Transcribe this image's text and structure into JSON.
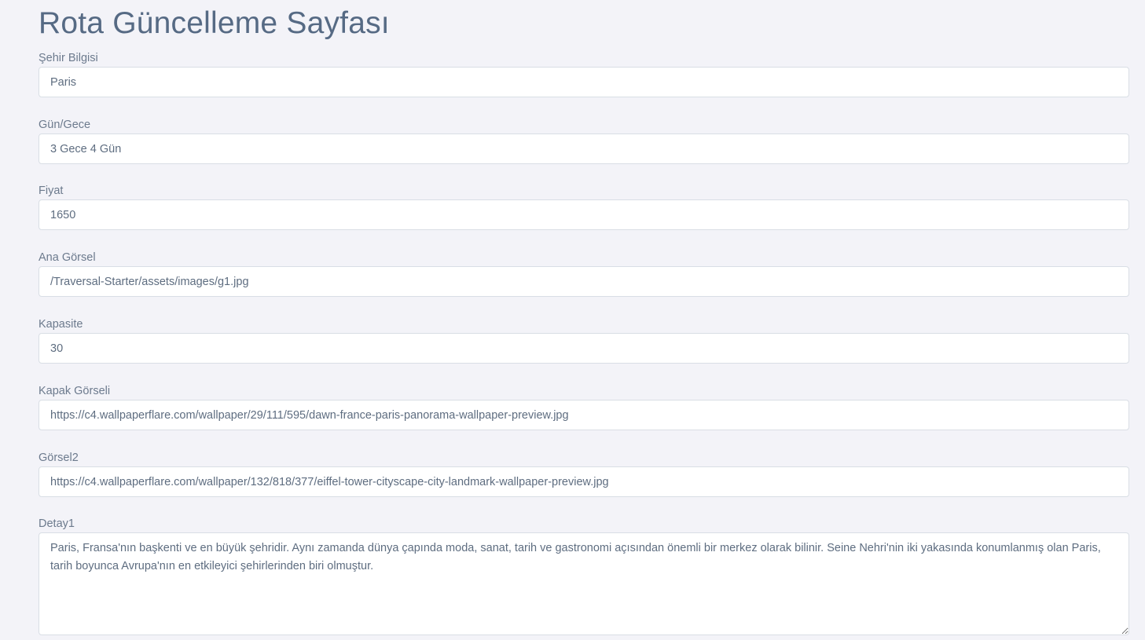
{
  "page": {
    "title": "Rota Güncelleme Sayfası"
  },
  "fields": {
    "city": {
      "label": "Şehir Bilgisi",
      "value": "Paris"
    },
    "day_night": {
      "label": "Gün/Gece",
      "value": "3 Gece 4 Gün"
    },
    "price": {
      "label": "Fiyat",
      "value": "1650"
    },
    "main_image": {
      "label": "Ana Görsel",
      "value": "/Traversal-Starter/assets/images/g1.jpg"
    },
    "capacity": {
      "label": "Kapasite",
      "value": "30"
    },
    "cover_image": {
      "label": "Kapak Görseli",
      "value": "https://c4.wallpaperflare.com/wallpaper/29/111/595/dawn-france-paris-panorama-wallpaper-preview.jpg"
    },
    "image2": {
      "label": "Görsel2",
      "value": "https://c4.wallpaperflare.com/wallpaper/132/818/377/eiffel-tower-cityscape-city-landmark-wallpaper-preview.jpg"
    },
    "detail1": {
      "label": "Detay1",
      "value": "Paris, Fransa'nın başkenti ve en büyük şehridir. Aynı zamanda dünya çapında moda, sanat, tarih ve gastronomi açısından önemli bir merkez olarak bilinir. Seine Nehri'nin iki yakasında konumlanmış olan Paris, tarih boyunca Avrupa'nın en etkileyici şehirlerinden biri olmuştur."
    }
  }
}
